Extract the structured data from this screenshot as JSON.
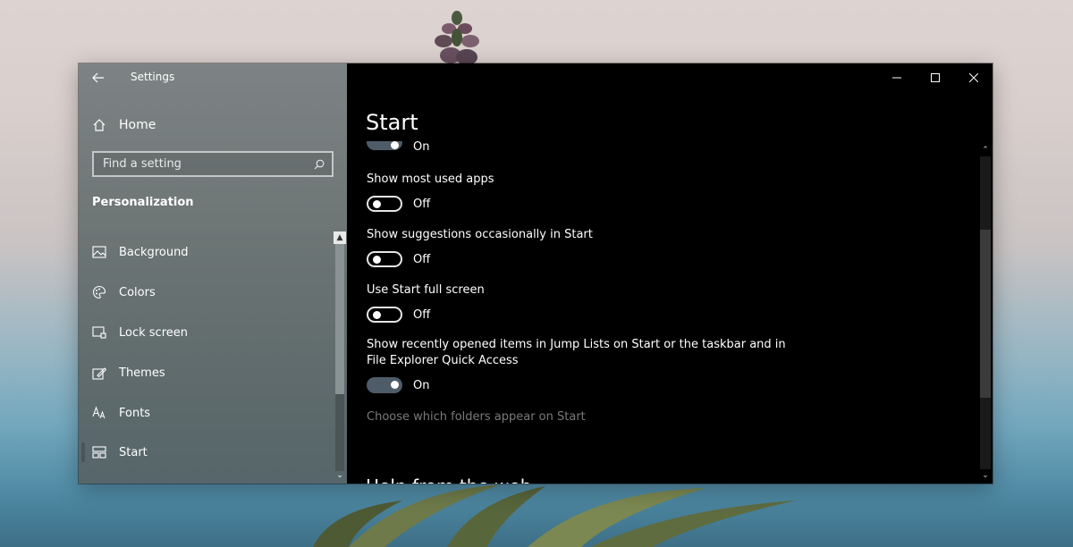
{
  "window": {
    "app_title": "Settings"
  },
  "sidebar": {
    "home_label": "Home",
    "search_placeholder": "Find a setting",
    "section_title": "Personalization",
    "items": [
      {
        "label": "Background",
        "icon": "picture-icon"
      },
      {
        "label": "Colors",
        "icon": "palette-icon"
      },
      {
        "label": "Lock screen",
        "icon": "lock-screen-icon"
      },
      {
        "label": "Themes",
        "icon": "themes-icon"
      },
      {
        "label": "Fonts",
        "icon": "fonts-icon"
      },
      {
        "label": "Start",
        "icon": "start-icon",
        "selected": true
      }
    ]
  },
  "main": {
    "title": "Start",
    "settings": [
      {
        "label": "",
        "state": "On",
        "on": true
      },
      {
        "label": "Show most used apps",
        "state": "Off",
        "on": false
      },
      {
        "label": "Show suggestions occasionally in Start",
        "state": "Off",
        "on": false
      },
      {
        "label": "Use Start full screen",
        "state": "Off",
        "on": false
      },
      {
        "label_line1": "Show recently opened items in Jump Lists on Start or the taskbar and in",
        "label_line2": "File Explorer Quick Access",
        "state": "On",
        "on": true
      }
    ],
    "folders_link": "Choose which folders appear on Start",
    "next_heading": "Help from the web"
  },
  "colors": {
    "content_bg": "#000000",
    "toggle_on": "#4e5c69",
    "link_disabled": "#7a7a7a"
  }
}
